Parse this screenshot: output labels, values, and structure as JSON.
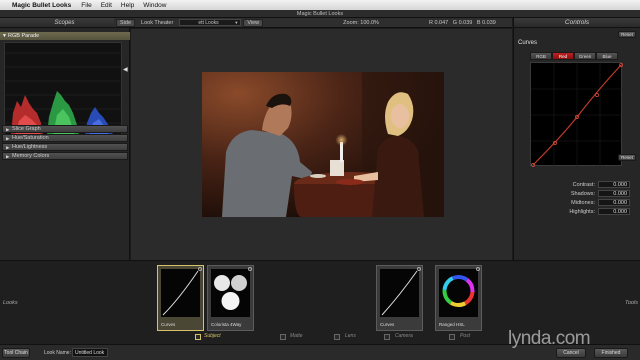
{
  "menubar": {
    "apple_glyph": "",
    "app_name": "Magic Bullet Looks",
    "items": [
      "File",
      "Edit",
      "Help",
      "Window"
    ]
  },
  "window": {
    "title": "Magic Bullet Looks"
  },
  "scopes": {
    "header": "Scopes",
    "rgb_parade_label": "RGB Parade",
    "collapsed_sections": [
      "Slice Graph",
      "Hue/Saturation",
      "Hue/Lightness",
      "Memory Colors"
    ]
  },
  "toolbar": {
    "side_label": "Side",
    "look_theater_label": "Look Theater",
    "look_theater_value": "ett Looks",
    "view_label": "View",
    "zoom_label": "Zoom:",
    "zoom_value": "100.0%",
    "r_label": "R",
    "r_value": "0.047",
    "g_label": "G",
    "g_value": "0.039",
    "b_label": "B",
    "b_value": "0.039"
  },
  "controls": {
    "header": "Controls",
    "reset_top": "Reset",
    "curves_label": "Curves",
    "channel_tabs": [
      "RGB",
      "Red",
      "Green",
      "Blue"
    ],
    "active_channel": "Red",
    "reset_mid": "Reset",
    "rows": [
      {
        "label": "Contrast:",
        "value": "0.000"
      },
      {
        "label": "Shadows:",
        "value": "0.000"
      },
      {
        "label": "Midtones:",
        "value": "0.000"
      },
      {
        "label": "Highlights:",
        "value": "0.000"
      }
    ],
    "curve_color": "#c0392b"
  },
  "looks": {
    "left_label": "Looks",
    "right_label": "Tools",
    "tools": [
      {
        "label": "Curves",
        "type": "curves"
      },
      {
        "label": "Colorista 4Way",
        "type": "colorwheels"
      },
      {
        "label": "Curves",
        "type": "curves"
      },
      {
        "label": "Ranged HSL",
        "type": "hsl"
      }
    ],
    "categories": [
      {
        "label": "Subject",
        "active": true
      },
      {
        "label": "Matte",
        "active": false
      },
      {
        "label": "Lens",
        "active": false
      },
      {
        "label": "Camera",
        "active": false
      },
      {
        "label": "Post",
        "active": false
      }
    ]
  },
  "bottom": {
    "tool_chain_label": "Tool Chain",
    "look_name_label": "Look Name:",
    "look_name_value": "Untitled Look",
    "cancel_label": "Cancel",
    "finished_label": "Finished"
  },
  "watermark": {
    "text": "lynda.com"
  },
  "colors": {
    "accent_gold": "#d6c26a",
    "active_red": "#c02020",
    "panel_bg": "#262626"
  }
}
